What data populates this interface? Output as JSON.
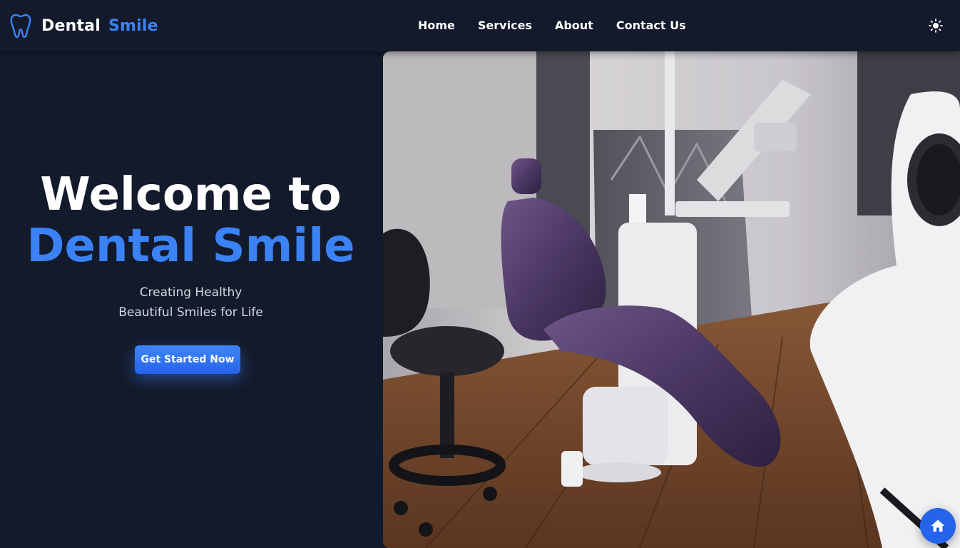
{
  "brand": {
    "name_part_1": "Dental",
    "name_part_2": "Smile",
    "logo_icon": "tooth-icon"
  },
  "nav": {
    "links": [
      {
        "label": "Home"
      },
      {
        "label": "Services"
      },
      {
        "label": "About"
      },
      {
        "label": "Contact Us"
      }
    ],
    "theme_toggle_icon": "sun-icon"
  },
  "hero": {
    "title_line_1": "Welcome to",
    "title_line_2": "Dental Smile",
    "subtitle_line_1": "Creating Healthy",
    "subtitle_line_2": "Beautiful Smiles for Life",
    "cta_label": "Get Started Now",
    "image_subject": "dental-clinic-photo"
  },
  "floating": {
    "home_icon": "home-icon"
  },
  "colors": {
    "background": "#131a2b",
    "accent": "#3b82f6",
    "text": "#ffffff",
    "subtext": "#d5d9e3"
  }
}
